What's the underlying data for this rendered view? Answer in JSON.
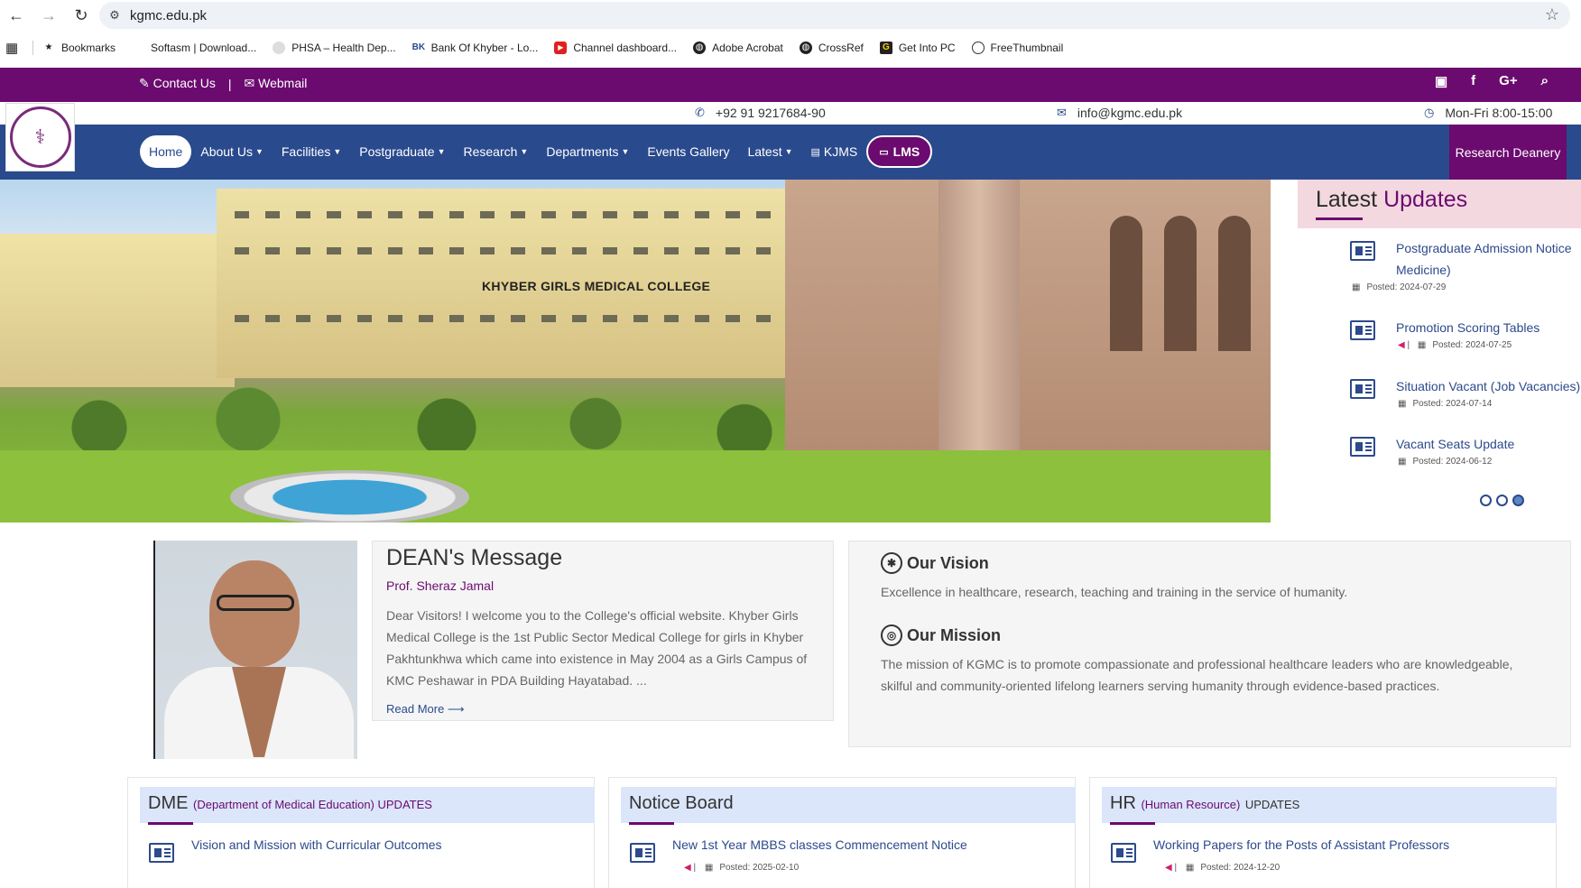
{
  "browser": {
    "url": "kgmc.edu.pk",
    "bookmarks": [
      {
        "label": "Bookmarks",
        "icon": "star-icon"
      },
      {
        "label": "Softasm | Download...",
        "icon": "softasm-icon"
      },
      {
        "label": "PHSA – Health Dep...",
        "icon": "phsa-icon"
      },
      {
        "label": "Bank Of Khyber - Lo...",
        "icon": "bok-icon"
      },
      {
        "label": "Channel dashboard...",
        "icon": "youtube-icon"
      },
      {
        "label": "Adobe Acrobat",
        "icon": "globe-icon"
      },
      {
        "label": "CrossRef",
        "icon": "globe-icon"
      },
      {
        "label": "Get Into PC",
        "icon": "getintopc-icon"
      },
      {
        "label": "FreeThumbnail",
        "icon": "freethumbnail-icon"
      }
    ]
  },
  "topbar": {
    "contact_label": "Contact Us",
    "separator": "|",
    "webmail_label": "Webmail",
    "color": "#6b0b6f"
  },
  "contact": {
    "phone": "+92 91 9217684-90",
    "email": "info@kgmc.edu.pk",
    "hours": "Mon-Fri 8:00-15:00"
  },
  "nav": {
    "color": "#2a4a8e",
    "items": [
      {
        "label": "Home"
      },
      {
        "label": "About Us"
      },
      {
        "label": "Facilities"
      },
      {
        "label": "Postgraduate"
      },
      {
        "label": "Research"
      },
      {
        "label": "Departments"
      },
      {
        "label": "Events Gallery"
      },
      {
        "label": "Latest"
      },
      {
        "label": "KJMS"
      },
      {
        "label": "LMS"
      }
    ],
    "research_deanery": "Research Deanery"
  },
  "hero": {
    "caption": "KHYBER GIRLS MEDICAL COLLEGE"
  },
  "updates": {
    "title_part1": "Latest",
    "title_part2": "Updates",
    "items": [
      {
        "title_line1": "Postgraduate Admission Notice",
        "title_line2": "Medicine)",
        "posted": "Posted: 2024-07-29"
      },
      {
        "title_line1": "Promotion Scoring Tables",
        "posted": "Posted: 2024-07-25"
      },
      {
        "title_line1": "Situation Vacant (Job Vacancies)",
        "posted": "Posted: 2024-07-14"
      },
      {
        "title_line1": "Vacant Seats Update",
        "posted": "Posted: 2024-06-12"
      }
    ]
  },
  "dean": {
    "title": "DEAN's Message",
    "name": "Prof. Sheraz Jamal",
    "message": "Dear Visitors!  I welcome you to the College's official website. Khyber Girls Medical College is the 1st Public Sector Medical College for girls in Khyber Pakhtunkhwa which came into existence in May 2004 as a Girls Campus of KMC Peshawar in PDA Building Hayatabad. ...",
    "read_more": "Read More ⟶"
  },
  "vision": {
    "title": "Our Vision",
    "text": "Excellence in healthcare, research, teaching and training in the service of humanity."
  },
  "mission": {
    "title": "Our Mission",
    "text": "The mission of KGMC is to promote compassionate and professional healthcare leaders who are knowledgeable, skilful and community-oriented lifelong learners serving humanity through evidence-based practices."
  },
  "columns": {
    "dme": {
      "title": "DME",
      "subtitle": "(Department of Medical Education) UPDATES",
      "item": "Vision and Mission with Curricular Outcomes"
    },
    "notice": {
      "title": "Notice Board",
      "item": "New 1st Year MBBS classes Commencement Notice",
      "posted": "Posted: 2025-02-10"
    },
    "hr": {
      "title": "HR",
      "subtitle": "(Human Resource)",
      "subtitle2": "UPDATES",
      "item": "Working Papers for the Posts of Assistant Professors",
      "posted": "Posted: 2024-12-20"
    }
  }
}
